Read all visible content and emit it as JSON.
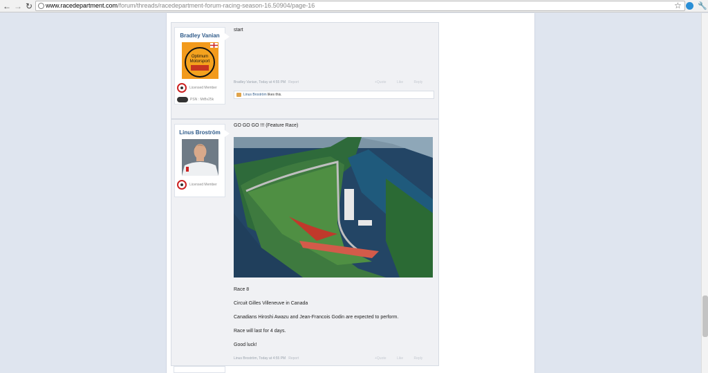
{
  "browser": {
    "url_domain": "www.racedepartment.com",
    "url_path": "/forum/threads/racedepartment-forum-racing-season-16.50904/page-16"
  },
  "posts": [
    {
      "username": "Bradley Vanian",
      "avatar_text": [
        "Optimum",
        "Motorsport"
      ],
      "role": "Licensed Member",
      "psn": "PSN : MrBv25k",
      "message": "start",
      "meta_author": "Bradley Vanian, Today at 4:55 PM",
      "report": "Report",
      "actions": [
        "+Quote",
        "Like",
        "Reply"
      ],
      "likes_name": "Linus Broström",
      "likes_suffix": " likes this."
    },
    {
      "username": "Linus Broström",
      "role": "Licensed Member",
      "message_title": "GO GO GO !!! (Feature Race)",
      "lines": [
        "Race 8",
        "Circuit Gilles Villeneuve in Canada",
        "Canadians Hiroshi Awazu and Jean-Francois Godin are expected to perform.",
        "Race will last for 4 days.",
        "Good luck!"
      ],
      "meta_author": "Linus Broström, Today at 4:55 PM",
      "report": "Report",
      "actions": [
        "+Quote",
        "Like",
        "Reply"
      ]
    }
  ]
}
